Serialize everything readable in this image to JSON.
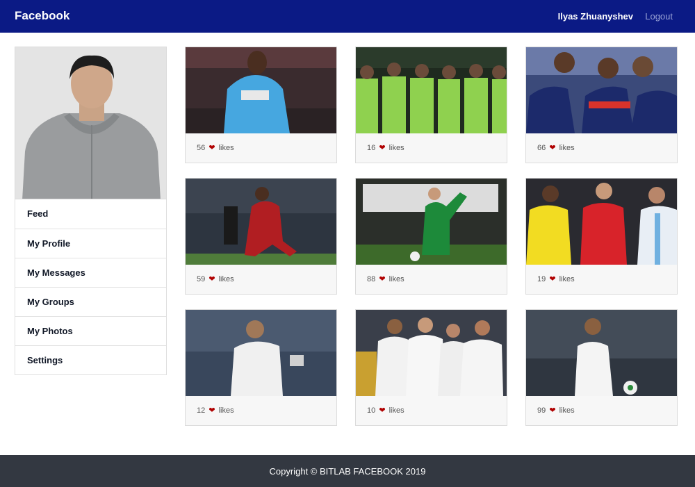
{
  "navbar": {
    "brand": "Facebook",
    "user_name": "Ilyas Zhuanyshev",
    "logout": "Logout"
  },
  "sidebar": {
    "items": [
      {
        "label": "Feed"
      },
      {
        "label": "My Profile"
      },
      {
        "label": "My Messages"
      },
      {
        "label": "My Groups"
      },
      {
        "label": "My Photos"
      },
      {
        "label": "Settings"
      }
    ]
  },
  "feed": {
    "likes_label": "likes",
    "heart_icon": "heart-icon",
    "posts": [
      {
        "likes": "56"
      },
      {
        "likes": "16"
      },
      {
        "likes": "66"
      },
      {
        "likes": "59"
      },
      {
        "likes": "88"
      },
      {
        "likes": "19"
      },
      {
        "likes": "12"
      },
      {
        "likes": "10"
      },
      {
        "likes": "99"
      }
    ]
  },
  "footer": {
    "copyright": "Copyright © BITLAB FACEBOOK 2019"
  },
  "colors": {
    "navbar": "#0b1a85",
    "footer": "#333841",
    "heart": "#b00000"
  }
}
